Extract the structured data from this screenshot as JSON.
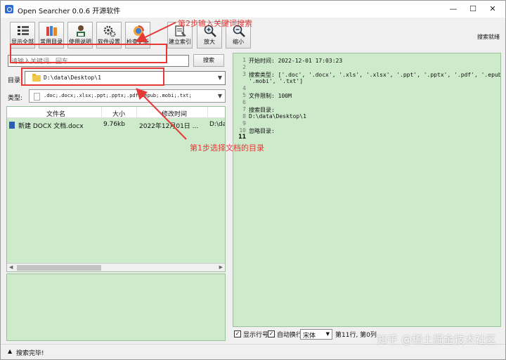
{
  "window": {
    "title": "Open Searcher 0.0.6 开源软件",
    "minimize": "—",
    "maximize": "☐",
    "close": "✕"
  },
  "toolbar": {
    "status": "搜索就绪",
    "buttons": [
      {
        "label": "显示全部",
        "icon": "list-icon"
      },
      {
        "label": "常用目录",
        "icon": "books-icon"
      },
      {
        "label": "使用说明",
        "icon": "reader-icon"
      },
      {
        "label": "软件设置",
        "icon": "gears-icon"
      },
      {
        "label": "检查更新",
        "icon": "update-icon"
      },
      {
        "label": "建立索引",
        "icon": "index-icon"
      },
      {
        "label": "放大",
        "icon": "zoom-in-icon"
      },
      {
        "label": "缩小",
        "icon": "zoom-out-icon"
      }
    ]
  },
  "search": {
    "placeholder": "请输入关键词，回车",
    "button": "搜索"
  },
  "directory": {
    "label": "目录:",
    "value": "D:\\data\\Desktop\\1"
  },
  "types": {
    "label": "类型:",
    "value": ".doc;.docx;.xlsx;.ppt;.pptx;.pdf;.epub;.mobi;.txt;"
  },
  "file_list": {
    "columns": [
      "文件名",
      "大小",
      "修改时间"
    ],
    "rows": [
      {
        "name": "新建 DOCX 文档.docx",
        "size": "9.76kb",
        "modified": "2022年12月01日 ...",
        "path": "D:\\dat"
      }
    ]
  },
  "log": {
    "lines": [
      {
        "n": "1",
        "text": "开始时间: 2022-12-01 17:03:23"
      },
      {
        "n": "2",
        "text": ""
      },
      {
        "n": "3",
        "text": "搜索类型: ['.doc', '.docx', '.xls', '.xlsx', '.ppt', '.pptx', '.pdf', '.epub',"
      },
      {
        "n": "",
        "text": "'.mobi', '.txt']"
      },
      {
        "n": "4",
        "text": ""
      },
      {
        "n": "5",
        "text": "文件限制: 100M"
      },
      {
        "n": "6",
        "text": ""
      },
      {
        "n": "7",
        "text": "搜索目录:"
      },
      {
        "n": "8",
        "text": "D:\\data\\Desktop\\1"
      },
      {
        "n": "9",
        "text": ""
      },
      {
        "n": "10",
        "text": "忽略目录:"
      },
      {
        "n": "11",
        "text": ""
      }
    ],
    "current_line": "11"
  },
  "options": {
    "show_line_numbers": "显示行号",
    "word_wrap": "自动换行",
    "font": "宋体",
    "position": "第11行, 第0列",
    "check": "✓"
  },
  "statusbar": {
    "icon": "▲",
    "text": "搜索完毕!"
  },
  "annotations": {
    "step2": "第2步输入关键词搜索",
    "step1": "第1步选择文档的目录",
    "color": "#e53935"
  },
  "watermark": "知乎 @稀土掘金技术社区",
  "colors": {
    "panel_green": "#cdeacb",
    "window_bg": "#f0f0f0"
  }
}
